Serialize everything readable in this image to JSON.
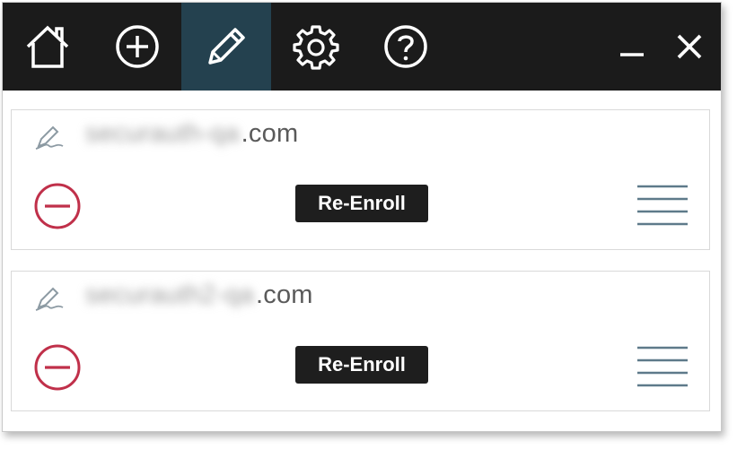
{
  "toolbar": {
    "buttons": [
      {
        "name": "home",
        "icon": "home-icon"
      },
      {
        "name": "add",
        "icon": "add-circle-icon"
      },
      {
        "name": "edit",
        "icon": "pencil-icon",
        "active": true
      },
      {
        "name": "settings",
        "icon": "gear-icon"
      },
      {
        "name": "help",
        "icon": "help-circle-icon"
      }
    ],
    "window_controls": {
      "minimize_icon": "minimize-icon",
      "close_icon": "close-icon"
    }
  },
  "colors": {
    "toolbar_bg": "#1b1b1b",
    "active_tab_bg": "#24414f",
    "remove_icon": "#c0304a",
    "button_bg": "#1e1e1e",
    "menu_lines": "#5e7a8a"
  },
  "accounts": [
    {
      "domain_hidden": "securauth-qa",
      "domain_suffix": ".com",
      "action_label": "Re-Enroll"
    },
    {
      "domain_hidden": "securauth2-qa",
      "domain_suffix": ".com",
      "action_label": "Re-Enroll"
    }
  ]
}
